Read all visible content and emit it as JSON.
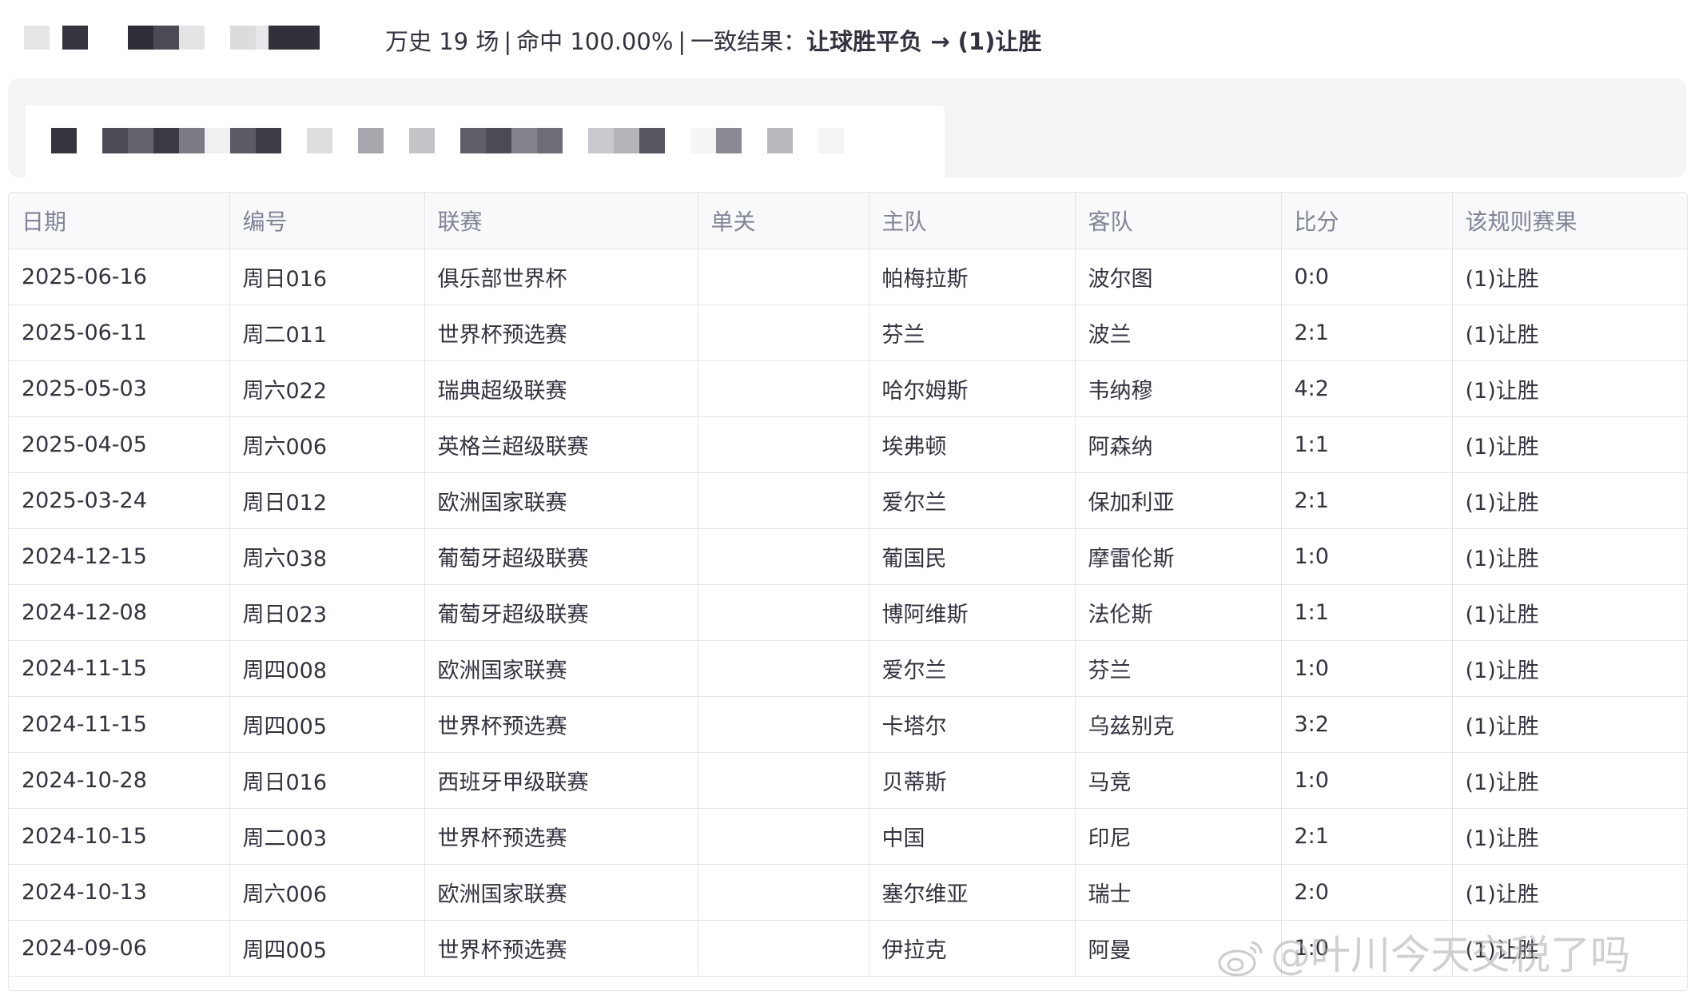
{
  "summary": {
    "history_label": "万史 19 场",
    "hit_label": "命中 100.00%",
    "consistent_prefix": "一致结果：",
    "consistent_value": "让球胜平负 → (1)让胜",
    "separator": "|"
  },
  "table": {
    "headers": [
      "日期",
      "编号",
      "联赛",
      "单关",
      "主队",
      "客队",
      "比分",
      "该规则赛果"
    ],
    "rows": [
      {
        "date": "2025-06-16",
        "code": "周日016",
        "league": "俱乐部世界杯",
        "single": "",
        "home": "帕梅拉斯",
        "away": "波尔图",
        "score": "0:0",
        "result": "(1)让胜"
      },
      {
        "date": "2025-06-11",
        "code": "周二011",
        "league": "世界杯预选赛",
        "single": "",
        "home": "芬兰",
        "away": "波兰",
        "score": "2:1",
        "result": "(1)让胜"
      },
      {
        "date": "2025-05-03",
        "code": "周六022",
        "league": "瑞典超级联赛",
        "single": "",
        "home": "哈尔姆斯",
        "away": "韦纳穆",
        "score": "4:2",
        "result": "(1)让胜"
      },
      {
        "date": "2025-04-05",
        "code": "周六006",
        "league": "英格兰超级联赛",
        "single": "",
        "home": "埃弗顿",
        "away": "阿森纳",
        "score": "1:1",
        "result": "(1)让胜"
      },
      {
        "date": "2025-03-24",
        "code": "周日012",
        "league": "欧洲国家联赛",
        "single": "",
        "home": "爱尔兰",
        "away": "保加利亚",
        "score": "2:1",
        "result": "(1)让胜"
      },
      {
        "date": "2024-12-15",
        "code": "周六038",
        "league": "葡萄牙超级联赛",
        "single": "",
        "home": "葡国民",
        "away": "摩雷伦斯",
        "score": "1:0",
        "result": "(1)让胜"
      },
      {
        "date": "2024-12-08",
        "code": "周日023",
        "league": "葡萄牙超级联赛",
        "single": "",
        "home": "博阿维斯",
        "away": "法伦斯",
        "score": "1:1",
        "result": "(1)让胜"
      },
      {
        "date": "2024-11-15",
        "code": "周四008",
        "league": "欧洲国家联赛",
        "single": "",
        "home": "爱尔兰",
        "away": "芬兰",
        "score": "1:0",
        "result": "(1)让胜"
      },
      {
        "date": "2024-11-15",
        "code": "周四005",
        "league": "世界杯预选赛",
        "single": "",
        "home": "卡塔尔",
        "away": "乌兹别克",
        "score": "3:2",
        "result": "(1)让胜"
      },
      {
        "date": "2024-10-28",
        "code": "周日016",
        "league": "西班牙甲级联赛",
        "single": "",
        "home": "贝蒂斯",
        "away": "马竞",
        "score": "1:0",
        "result": "(1)让胜"
      },
      {
        "date": "2024-10-15",
        "code": "周二003",
        "league": "世界杯预选赛",
        "single": "",
        "home": "中国",
        "away": "印尼",
        "score": "2:1",
        "result": "(1)让胜"
      },
      {
        "date": "2024-10-13",
        "code": "周六006",
        "league": "欧洲国家联赛",
        "single": "",
        "home": "塞尔维亚",
        "away": "瑞士",
        "score": "2:0",
        "result": "(1)让胜"
      },
      {
        "date": "2024-09-06",
        "code": "周四005",
        "league": "世界杯预选赛",
        "single": "",
        "home": "伊拉克",
        "away": "阿曼",
        "score": "1:0",
        "result": "(1)让胜"
      }
    ]
  },
  "watermark": {
    "text": "@叶川今天交税了吗",
    "icon": "weibo-icon"
  },
  "colors": {
    "header_bg": "#f8f9fb",
    "border": "#e4e5e9",
    "text": "#31333f",
    "muted": "#808495",
    "info_bg": "#f3f4f6"
  }
}
